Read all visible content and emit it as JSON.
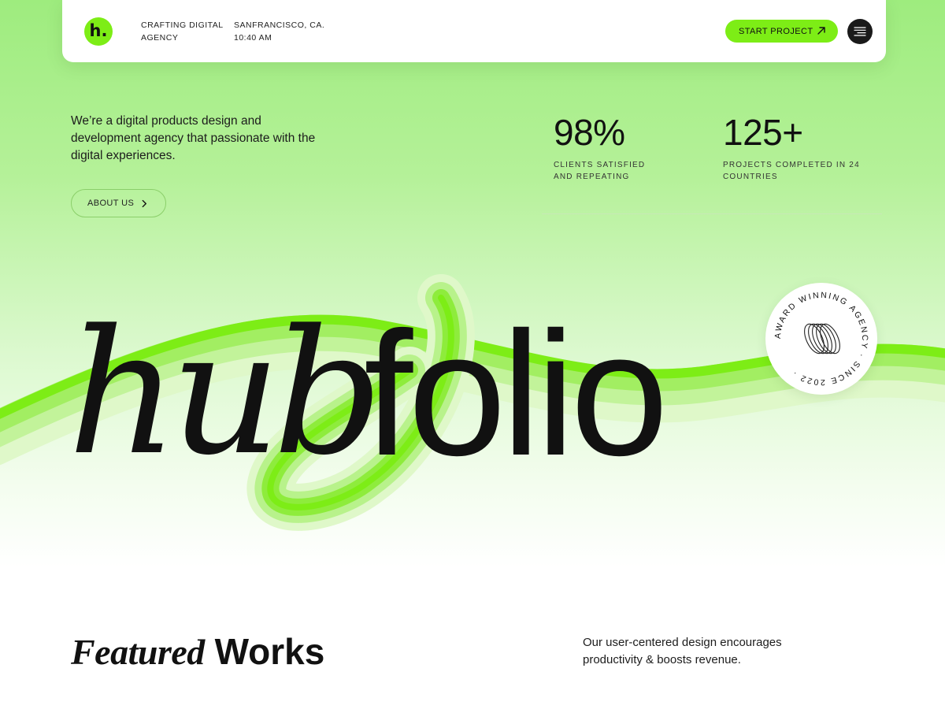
{
  "nav": {
    "logo_letter": "h.",
    "tagline": [
      "CRAFTING DIGITAL",
      "AGENCY"
    ],
    "location": [
      "SANFRANCISCO, CA.",
      "10:40 AM"
    ],
    "cta_label": "START PROJECT",
    "cta_icon": "arrow-up-right-icon",
    "menu_icon": "menu-icon"
  },
  "hero": {
    "intro": "We’re a digital products design and development agency that passionate with the digital experiences.",
    "about_label": "ABOUT US",
    "about_icon": "chevron-right-icon"
  },
  "stats": [
    {
      "value": "98%",
      "label": [
        "CLIENTS SATISFIED",
        "AND REPEATING"
      ]
    },
    {
      "value": "125+",
      "label": [
        "PROJECTS COMPLETED IN 24",
        "COUNTRIES"
      ]
    }
  ],
  "brand": {
    "part1": "hub",
    "part2": "folio"
  },
  "badge": {
    "text": "AWARD WINNING AGENCY · SINCE 2022 ·",
    "icon": "rings-icon"
  },
  "featured": {
    "title_italic": "Featured",
    "title_regular": "Works",
    "description": "Our user-centered design encourages productivity & boosts revenue."
  },
  "colors": {
    "accent": "#7ded16",
    "text": "#111111",
    "background_top": "#9eec7e",
    "background_bottom": "#ffffff"
  }
}
